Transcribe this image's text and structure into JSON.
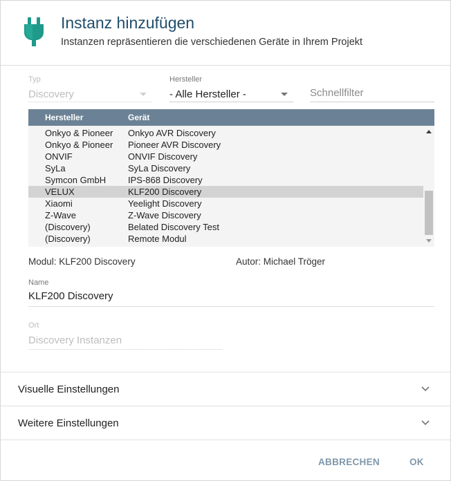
{
  "header": {
    "title": "Instanz hinzufügen",
    "subtitle": "Instanzen repräsentieren die verschiedenen Geräte in Ihrem Projekt",
    "icon": "plug-icon",
    "icon_color": "#1f9a8a"
  },
  "filters": {
    "type_label": "Typ",
    "type_value": "Discovery",
    "manufacturer_label": "Hersteller",
    "manufacturer_value": "- Alle Hersteller -",
    "quickfilter_placeholder": "Schnellfilter"
  },
  "table": {
    "columns": [
      "Hersteller",
      "Gerät"
    ],
    "header_color": "#6b8296",
    "rows": [
      {
        "manufacturer": "Onkyo & Pioneer",
        "device": "Onkyo AVR Discovery",
        "selected": false
      },
      {
        "manufacturer": "Onkyo & Pioneer",
        "device": "Pioneer AVR Discovery",
        "selected": false
      },
      {
        "manufacturer": "ONVIF",
        "device": "ONVIF Discovery",
        "selected": false
      },
      {
        "manufacturer": "SyLa",
        "device": "SyLa Discovery",
        "selected": false
      },
      {
        "manufacturer": "Symcon GmbH",
        "device": "IPS-868 Discovery",
        "selected": false
      },
      {
        "manufacturer": "VELUX",
        "device": "KLF200 Discovery",
        "selected": true
      },
      {
        "manufacturer": "Xiaomi",
        "device": "Yeelight Discovery",
        "selected": false
      },
      {
        "manufacturer": "Z-Wave",
        "device": "Z-Wave Discovery",
        "selected": false
      },
      {
        "manufacturer": "(Discovery)",
        "device": "Belated Discovery Test",
        "selected": false
      },
      {
        "manufacturer": "(Discovery)",
        "device": "Remote Modul",
        "selected": false
      }
    ]
  },
  "info": {
    "module": "Modul: KLF200 Discovery",
    "author": "Autor: Michael Tröger"
  },
  "name": {
    "label": "Name",
    "value": "KLF200 Discovery"
  },
  "location": {
    "label": "Ort",
    "value": "Discovery Instanzen"
  },
  "sections": {
    "visual": "Visuelle Einstellungen",
    "more": "Weitere Einstellungen"
  },
  "buttons": {
    "cancel": "ABBRECHEN",
    "ok": "OK",
    "color": "#7f97ab"
  }
}
